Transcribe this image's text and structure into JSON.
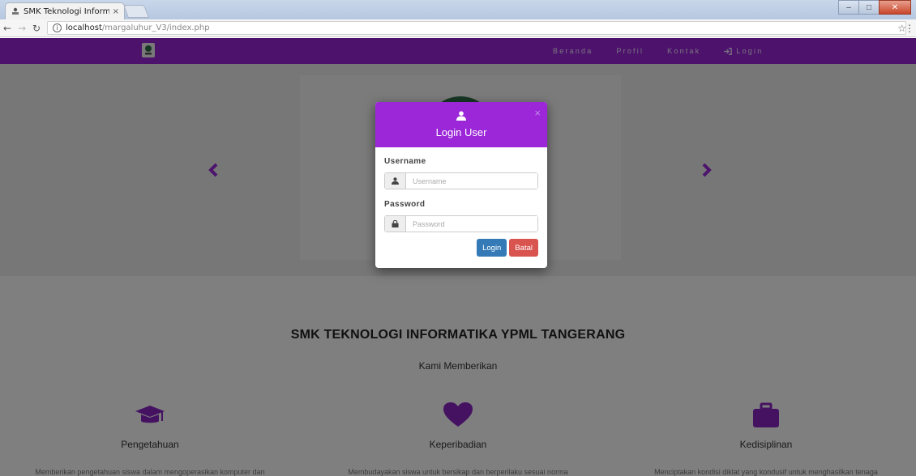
{
  "browser": {
    "tab_title": "SMK Teknologi Informati",
    "tab_close": "×",
    "url_host": "localhost",
    "url_path": "/margaluhur_V3/index.php"
  },
  "navbar": {
    "bg_color": "#9b27d9",
    "links": [
      {
        "label": "Beranda"
      },
      {
        "label": "Profil"
      },
      {
        "label": "Kontak"
      },
      {
        "label": "Login",
        "icon": "sign-in-icon"
      }
    ]
  },
  "main": {
    "school_title": "SMK TEKNOLOGI INFORMATIKA YPML TANGERANG",
    "subtitle": "Kami Memberikan",
    "features": [
      {
        "icon": "graduation-cap-icon",
        "title": "Pengetahuan",
        "desc": "Memberikan pengetahuan siswa dalam mengoperasikan komputer dan"
      },
      {
        "icon": "heart-icon",
        "title": "Keperibadian",
        "desc": "Membudayakan siswa untuk bersikap dan berperilaku sesuai norma"
      },
      {
        "icon": "briefcase-icon",
        "title": "Kedisiplinan",
        "desc": "Menciptakan kondisi diklat yang kondusif untuk menghasilkan tenaga"
      }
    ]
  },
  "modal": {
    "title": "Login User",
    "close": "×",
    "username_label": "Username",
    "username_placeholder": "Username",
    "password_label": "Password",
    "password_placeholder": "Password",
    "login_button": "Login",
    "cancel_button": "Batal"
  }
}
